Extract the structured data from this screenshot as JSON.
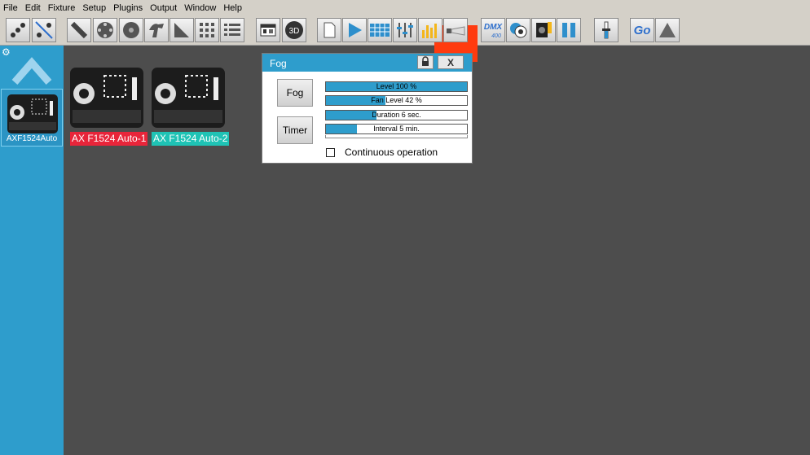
{
  "menubar": {
    "items": [
      "File",
      "Edit",
      "Fixture",
      "Setup",
      "Plugins",
      "Output",
      "Window",
      "Help"
    ]
  },
  "toolbar": {
    "icons": [
      "group-fixtures-icon",
      "ungroup-fixtures-icon",
      "pan-tilt-icon",
      "color-wheel-icon",
      "gobo-wheel-icon",
      "shape-icon",
      "prism-icon",
      "matrix-icon",
      "list-icon",
      "palette-icon",
      "3d-icon",
      "new-scene-icon",
      "play-icon",
      "grid-icon",
      "faders-icon",
      "level-meters-icon",
      "fog-machine-icon",
      "dmx-icon",
      "effects-icon",
      "moving-head-icon",
      "pause-icon",
      "master-fader-icon",
      "go-icon",
      "fade-icon"
    ],
    "dmx_label": "DMX",
    "dmx_sub": "400",
    "go_label": "Go",
    "threed_label": "3D",
    "highlight_color": "#ff3b0f"
  },
  "sidebar": {
    "fixture_label": "AXF1524Auto",
    "accent": "#2e9dcc"
  },
  "workspace": {
    "fixtures": [
      {
        "label": "AX F1524 Auto-1",
        "color": "#e8253a"
      },
      {
        "label": "AX F1524 Auto-2",
        "color": "#1fc3b5"
      }
    ]
  },
  "fog_panel": {
    "title": "Fog",
    "close_label": "X",
    "fog_button": "Fog",
    "timer_button": "Timer",
    "bars": [
      {
        "text": "Level 100 %",
        "fill": 1.0
      },
      {
        "text": "Fan Level 42 %",
        "fill": 0.42
      },
      {
        "text": "Duration 6 sec.",
        "fill": 0.36
      },
      {
        "text": "Interval 5 min.",
        "fill": 0.22
      }
    ],
    "continuous_label": "Continuous operation",
    "continuous_checked": false
  }
}
